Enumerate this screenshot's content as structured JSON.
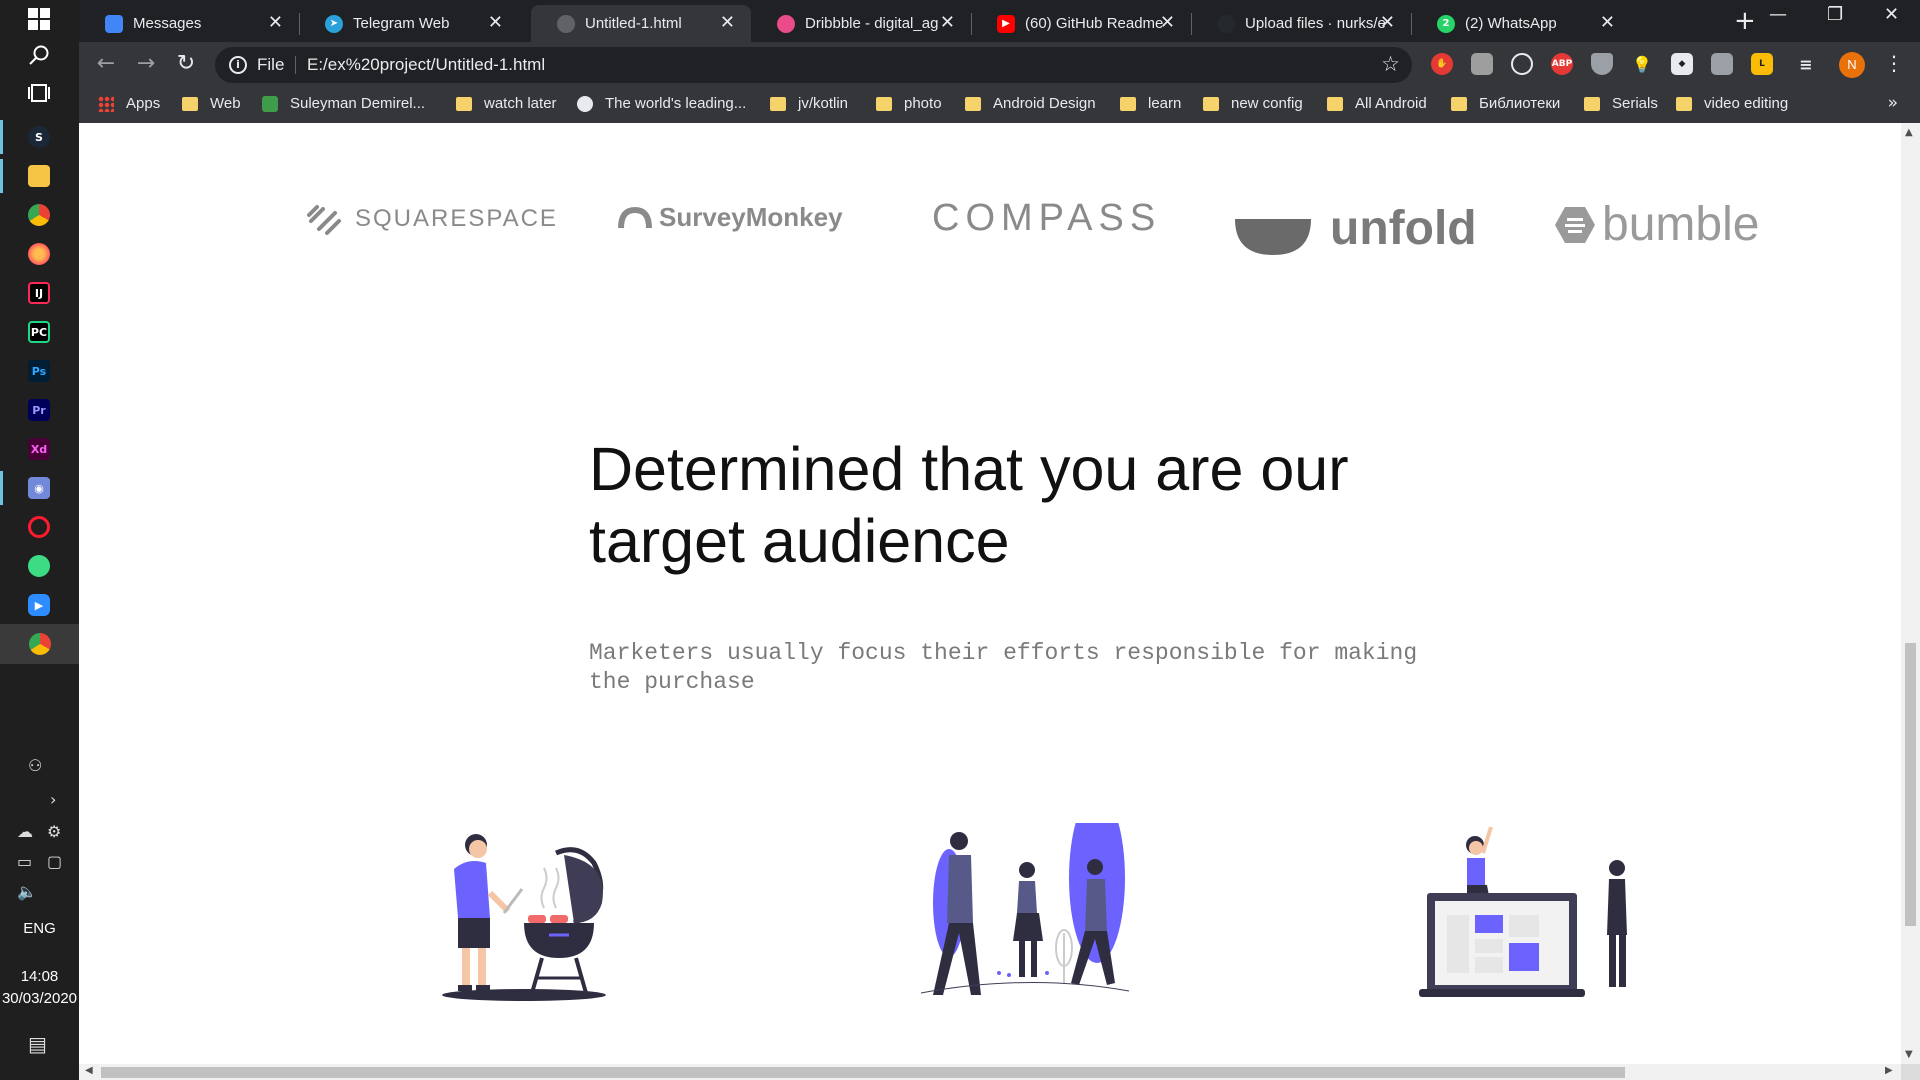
{
  "taskbar": {
    "language": "ENG",
    "time": "14:08",
    "date": "30/03/2020"
  },
  "tabs": [
    {
      "title": "Messages",
      "favicon_color": "#4285f4"
    },
    {
      "title": "Telegram Web",
      "favicon_color": "#2aa1da"
    },
    {
      "title": "Untitled-1.html",
      "favicon_color": "#5f6368"
    },
    {
      "title": "Dribbble - digital_ag",
      "favicon_color": "#ea4c89"
    },
    {
      "title": "(60) GitHub Readme",
      "favicon_color": "#ff0000"
    },
    {
      "title": "Upload files · nurks/e",
      "favicon_color": "#24292e"
    },
    {
      "title": "(2) WhatsApp",
      "favicon_color": "#25d366",
      "badge": "2"
    }
  ],
  "omnibox": {
    "scheme_label": "File",
    "url": "E:/ex%20project/Untitled-1.html"
  },
  "profile_initial": "N",
  "bookmarks": [
    {
      "label": "Apps",
      "icon": "apps-grid-icon"
    },
    {
      "label": "Web",
      "icon": "folder-icon"
    },
    {
      "label": "Suleyman Demirel...",
      "icon": "site-icon"
    },
    {
      "label": "watch later",
      "icon": "folder-icon"
    },
    {
      "label": "The world's leading...",
      "icon": "github-icon"
    },
    {
      "label": "jv/kotlin",
      "icon": "folder-icon"
    },
    {
      "label": "photo",
      "icon": "folder-icon"
    },
    {
      "label": "Android Design",
      "icon": "folder-icon"
    },
    {
      "label": "learn",
      "icon": "folder-icon"
    },
    {
      "label": "new config",
      "icon": "folder-icon"
    },
    {
      "label": "All Android",
      "icon": "folder-icon"
    },
    {
      "label": "Библиотеки",
      "icon": "folder-icon"
    },
    {
      "label": "Serials",
      "icon": "folder-icon"
    },
    {
      "label": "video editing",
      "icon": "folder-icon"
    }
  ],
  "page": {
    "logos": {
      "squarespace": "SQUARESPACE",
      "surveymonkey": "SurveyMonkey",
      "compass": "COMPASS",
      "unfold": "unfold",
      "bumble": "bumble"
    },
    "headline": "Determined that you are our target audience",
    "subtext": "Marketers usually focus their efforts responsible for making the purchase",
    "accent_color": "#6c63ff",
    "dark_color": "#2f2e41"
  }
}
